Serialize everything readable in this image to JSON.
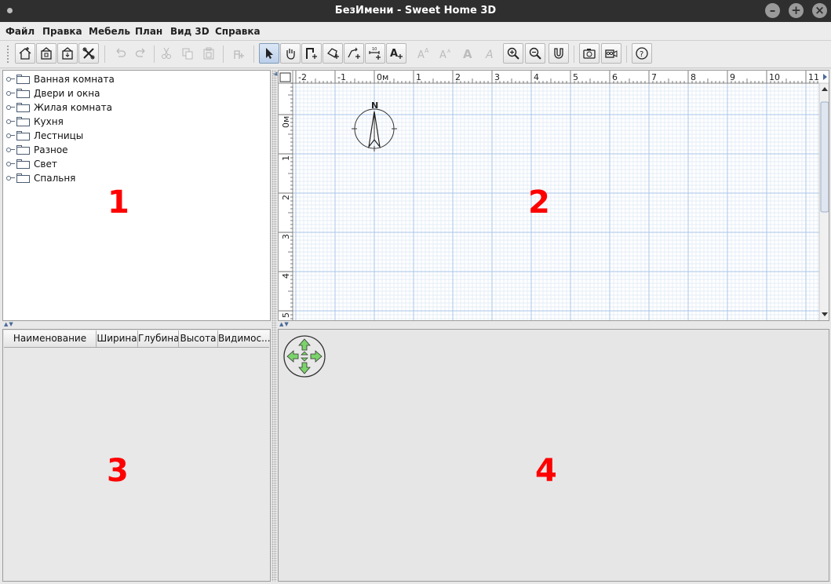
{
  "window": {
    "title": "БезИмени - Sweet Home 3D"
  },
  "menu": [
    "Файл",
    "Правка",
    "Мебель",
    "План",
    "Вид 3D",
    "Справка"
  ],
  "toolbar": {
    "buttons": [
      {
        "name": "new-home-icon",
        "enabled": true
      },
      {
        "name": "open-icon",
        "enabled": true
      },
      {
        "name": "save-icon",
        "enabled": true
      },
      {
        "name": "preferences-icon",
        "enabled": true
      },
      {
        "name": "undo-icon",
        "enabled": false
      },
      {
        "name": "redo-icon",
        "enabled": false
      },
      {
        "name": "cut-icon",
        "enabled": false
      },
      {
        "name": "copy-icon",
        "enabled": false
      },
      {
        "name": "paste-icon",
        "enabled": false
      },
      {
        "name": "add-furniture-icon",
        "enabled": false
      },
      {
        "name": "select-mode-icon",
        "enabled": true,
        "pressed": true
      },
      {
        "name": "pan-mode-icon",
        "enabled": true
      },
      {
        "name": "create-walls-icon",
        "enabled": true
      },
      {
        "name": "create-rooms-icon",
        "enabled": true
      },
      {
        "name": "create-polylines-icon",
        "enabled": true
      },
      {
        "name": "create-dimensions-icon",
        "enabled": true
      },
      {
        "name": "add-text-icon",
        "enabled": true
      },
      {
        "name": "increase-text-size-icon",
        "enabled": false
      },
      {
        "name": "decrease-text-size-icon",
        "enabled": false
      },
      {
        "name": "bold-text-icon",
        "enabled": false
      },
      {
        "name": "italic-text-icon",
        "enabled": false
      },
      {
        "name": "zoom-in-icon",
        "enabled": true
      },
      {
        "name": "zoom-out-icon",
        "enabled": true
      },
      {
        "name": "magnetism-icon",
        "enabled": true
      },
      {
        "name": "create-photo-icon",
        "enabled": true
      },
      {
        "name": "create-video-icon",
        "enabled": true
      },
      {
        "name": "help-icon",
        "enabled": true
      }
    ]
  },
  "catalog": {
    "categories": [
      "Ванная комната",
      "Двери и окна",
      "Жилая комната",
      "Кухня",
      "Лестницы",
      "Разное",
      "Свет",
      "Спальня"
    ]
  },
  "furniture_table": {
    "columns": [
      "Наименование",
      "Ширина",
      "Глубина",
      "Высота",
      "Видимос..."
    ]
  },
  "plan": {
    "ruler_x_labels": [
      "-2",
      "-1",
      "0м",
      "1",
      "2",
      "3",
      "4",
      "5",
      "6",
      "7",
      "8",
      "9",
      "10",
      "11"
    ],
    "ruler_y_labels": [
      "0м",
      "1",
      "2",
      "3",
      "4",
      "5"
    ],
    "compass_label": "N"
  },
  "annotations": {
    "panel1": "1",
    "panel2": "2",
    "panel3": "3",
    "panel4": "4"
  },
  "colors": {
    "annotation": "#ff0000",
    "grid_major": "#a9c6e8",
    "grid_minor": "#dde8f4",
    "nav_green": "#7bd36b"
  }
}
